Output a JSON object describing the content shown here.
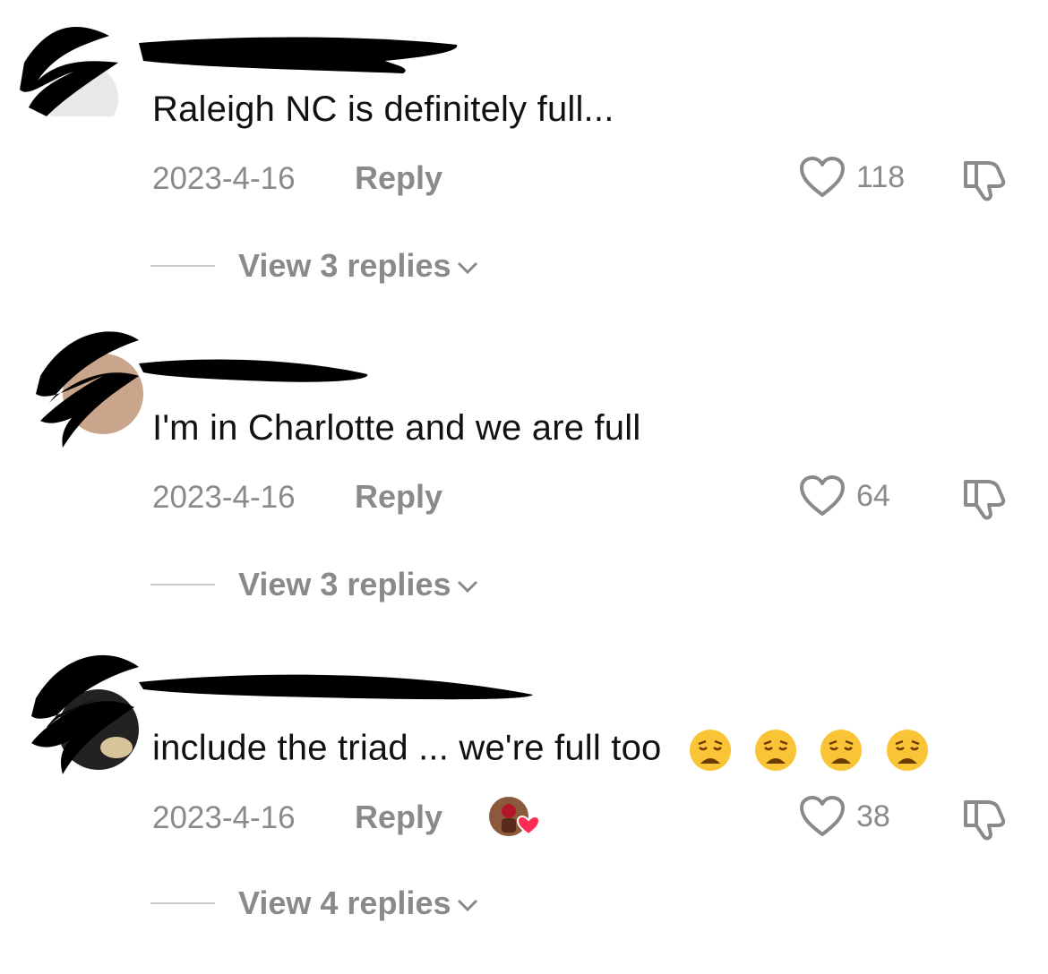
{
  "comments": [
    {
      "text": "Raleigh NC is definitely full...",
      "date": "2023-4-16",
      "reply_label": "Reply",
      "likes": "118",
      "view_replies": "View 3 replies"
    },
    {
      "text": "I'm in Charlotte and we are full",
      "date": "2023-4-16",
      "reply_label": "Reply",
      "likes": "64",
      "view_replies": "View 3 replies"
    },
    {
      "text": "include the triad ... we're full too",
      "emoji": "weary-face",
      "emoji_count": 4,
      "date": "2023-4-16",
      "reply_label": "Reply",
      "likes": "38",
      "view_replies": "View 4 replies"
    }
  ],
  "colors": {
    "text": "#111111",
    "meta": "#8a8a8a",
    "redaction": "#000000",
    "liked_heart": "#fe2c55"
  }
}
